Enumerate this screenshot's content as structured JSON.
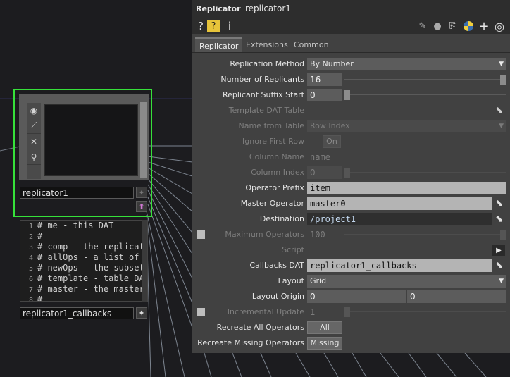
{
  "network": {
    "node_name": "replicator1",
    "dat_name": "replicator1_callbacks",
    "dat_lines": [
      {
        "n": "1",
        "t": "# me - this DAT"
      },
      {
        "n": "2",
        "t": "#"
      },
      {
        "n": "3",
        "t": "# comp - the replicato"
      },
      {
        "n": "4",
        "t": "# allOps - a list of a"
      },
      {
        "n": "5",
        "t": "# newOps - the subset"
      },
      {
        "n": "6",
        "t": "# template - table DAT"
      },
      {
        "n": "7",
        "t": "# master - the master"
      },
      {
        "n": "8",
        "t": "#"
      }
    ],
    "node_icons": [
      "eye-icon",
      "pulse-icon",
      "close-icon",
      "link-icon"
    ]
  },
  "panel": {
    "op_type": "Replicator",
    "op_name": "replicator1",
    "toolbar": {
      "help": "?",
      "info": "i"
    },
    "tabs": [
      "Replicator",
      "Extensions",
      "Common"
    ],
    "params": {
      "replication_method": {
        "label": "Replication Method",
        "value": "By Number"
      },
      "num_replicants": {
        "label": "Number of Replicants",
        "value": "16"
      },
      "suffix_start": {
        "label": "Replicant Suffix Start",
        "value": "0"
      },
      "template_dat": {
        "label": "Template DAT Table",
        "value": ""
      },
      "name_from_table": {
        "label": "Name from Table",
        "value": "Row Index"
      },
      "ignore_first_row": {
        "label": "Ignore First Row",
        "value": "On"
      },
      "column_name": {
        "label": "Column Name",
        "value": "name"
      },
      "column_index": {
        "label": "Column Index",
        "value": "0"
      },
      "operator_prefix": {
        "label": "Operator Prefix",
        "value": "item"
      },
      "master_operator": {
        "label": "Master Operator",
        "value": "master0"
      },
      "destination": {
        "label": "Destination",
        "value": "/project1"
      },
      "max_operators": {
        "label": "Maximum Operators",
        "value": "100"
      },
      "script": {
        "label": "Script",
        "value": ""
      },
      "callbacks_dat": {
        "label": "Callbacks DAT",
        "value": "replicator1_callbacks"
      },
      "layout": {
        "label": "Layout",
        "value": "Grid"
      },
      "layout_origin": {
        "label": "Layout Origin",
        "x": "0",
        "y": "0"
      },
      "incremental_update": {
        "label": "Incremental Update",
        "value": "1"
      },
      "recreate_all": {
        "label": "Recreate All Operators",
        "button": "All"
      },
      "recreate_missing": {
        "label": "Recreate Missing Operators",
        "button": "Missing"
      }
    }
  },
  "colors": {
    "selection": "#36e13a",
    "panel_bg": "#414141",
    "header_bg": "#2d2d2d"
  }
}
